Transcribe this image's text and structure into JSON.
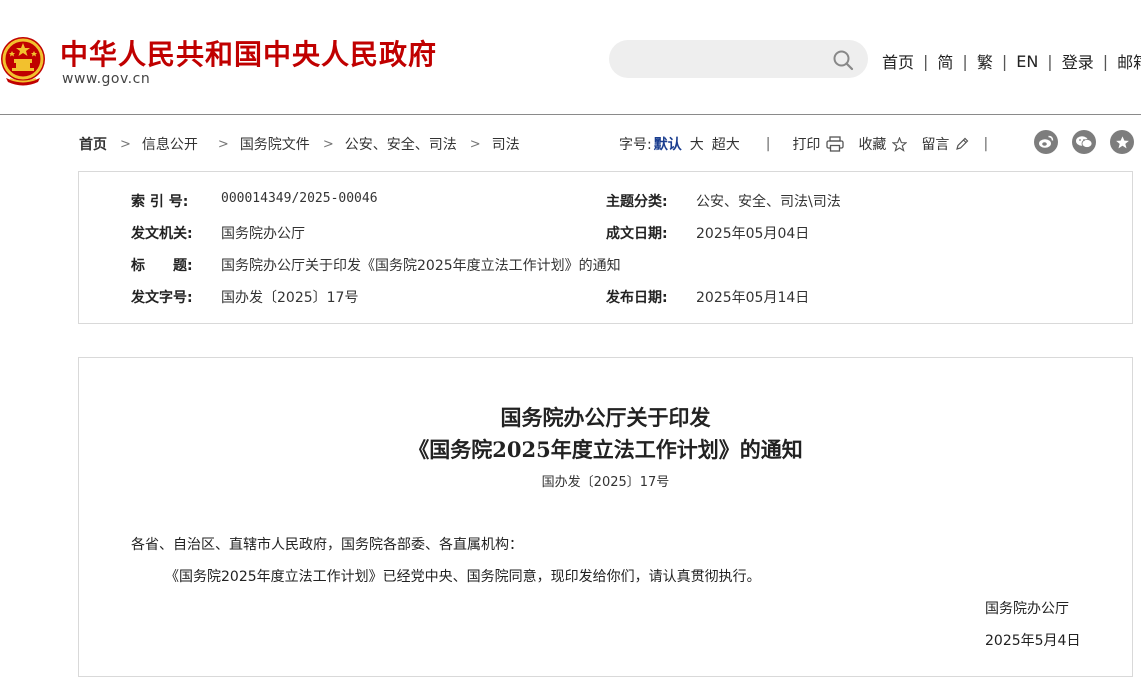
{
  "header": {
    "site_title": "中华人民共和国中央人民政府",
    "site_url": "www.gov.cn",
    "search_placeholder": "",
    "nav": [
      "首页",
      "简",
      "繁",
      "EN",
      "登录",
      "邮箱"
    ]
  },
  "breadcrumb": [
    "首页",
    "信息公开",
    "国务院文件",
    "公安、安全、司法",
    "司法"
  ],
  "tools": {
    "font_size_label": "字号:",
    "font_sizes": [
      "默认",
      "大",
      "超大"
    ],
    "print": "打印",
    "favorite": "收藏",
    "comment": "留言"
  },
  "meta": {
    "index_no": {
      "label": "索 引 号:",
      "value": "000014349/2025-00046"
    },
    "topic": {
      "label": "主题分类:",
      "value": "公安、安全、司法\\司法"
    },
    "issuer": {
      "label": "发文机关:",
      "value": "国务院办公厅"
    },
    "written_date": {
      "label": "成文日期:",
      "value": "2025年05月04日"
    },
    "title": {
      "label": "标　　题:",
      "value": "国务院办公厅关于印发《国务院2025年度立法工作计划》的通知"
    },
    "doc_no": {
      "label": "发文字号:",
      "value": "国办发〔2025〕17号"
    },
    "publish_date": {
      "label": "发布日期:",
      "value": "2025年05月14日"
    }
  },
  "document": {
    "title_line1": "国务院办公厅关于印发",
    "title_line2": "《国务院2025年度立法工作计划》的通知",
    "doc_no": "国办发〔2025〕17号",
    "salutation": "各省、自治区、直辖市人民政府，国务院各部委、各直属机构：",
    "body": "《国务院2025年度立法工作计划》已经党中央、国务院同意，现印发给你们，请认真贯彻执行。",
    "signature": "国务院办公厅",
    "date": "2025年5月4日"
  },
  "colors": {
    "brand_red": "#c00000",
    "emblem_gold": "#f2c12e",
    "selected_blue": "#1a3d8f"
  },
  "icons": [
    "national-emblem-icon",
    "search-icon",
    "print-icon",
    "star-icon",
    "pencil-icon",
    "weibo-icon",
    "wechat-icon",
    "favorite-share-icon"
  ]
}
